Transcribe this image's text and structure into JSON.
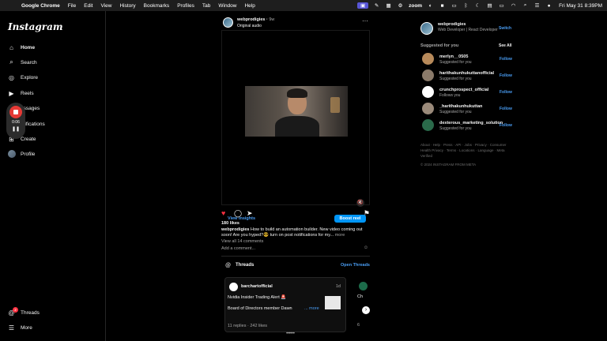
{
  "menubar": {
    "app": "Google Chrome",
    "menus": [
      "File",
      "Edit",
      "View",
      "History",
      "Bookmarks",
      "Profiles",
      "Tab",
      "Window",
      "Help"
    ],
    "zoom_label": "zoom",
    "clock": "Fri May 31  8:39PM"
  },
  "sidebar": {
    "logo": "Instagram",
    "items": [
      {
        "label": "Home",
        "icon": "home-icon"
      },
      {
        "label": "Search",
        "icon": "search-icon"
      },
      {
        "label": "Explore",
        "icon": "compass-icon"
      },
      {
        "label": "Reels",
        "icon": "reels-icon"
      },
      {
        "label": "essages",
        "icon": "messenger-icon"
      },
      {
        "label": "otifications",
        "icon": "heart-icon"
      },
      {
        "label": "Create",
        "icon": "plus-square-icon"
      },
      {
        "label": "Profile",
        "icon": "avatar"
      }
    ],
    "threads": "Threads",
    "threads_badge": "2",
    "more": "More"
  },
  "recorder": {
    "time": "0:06"
  },
  "post": {
    "username": "webprodigies",
    "time": "9w",
    "audio": "Original audio",
    "view_insights": "View insights",
    "boost": "Boost reel",
    "likes": "180 likes",
    "caption_user": "webprodigies",
    "caption_text": "How to build an automation builder. New video coming out soon! Are you hyped?😎 turn on post notifications for my...",
    "caption_more": "more",
    "view_comments": "View all 14 comments",
    "add_comment": "Add a comment..."
  },
  "threads": {
    "title": "Threads",
    "open": "Open Threads",
    "card": {
      "name": "barchartofficial",
      "time": "1d",
      "line1": "Nvidia Insider Trading Alert 🚨",
      "line2": "Board of Directors member Dawn",
      "more": "... more",
      "stats": "11 replies  ·  242 likes"
    },
    "peek": {
      "text": "Ch",
      "stats": "6"
    },
    "pager": "• • • • • •"
  },
  "right": {
    "username": "webprodigies",
    "bio": "Web Developer | React Developer",
    "switch": "Switch",
    "suggested_title": "Suggested for you",
    "see_all": "See All",
    "suggestions": [
      {
        "name": "merlyn__0505",
        "sub": "Suggested for you",
        "follow": "Follow",
        "color": "#b88a5a"
      },
      {
        "name": "harithakunhukuttanofficial",
        "sub": "Suggested for you",
        "follow": "Follow",
        "color": "#8a7a6a"
      },
      {
        "name": "crunchprospect_official",
        "sub": "Follows you",
        "follow": "Follow",
        "color": "#ffffff"
      },
      {
        "name": "_harithakunhukuttan",
        "sub": "Suggested for you",
        "follow": "Follow",
        "color": "#9a8a7a"
      },
      {
        "name": "dexterous_marketing_solution",
        "sub": "Suggested for you",
        "follow": "Follow",
        "color": "#2a6a4a"
      }
    ],
    "footer": "About · Help · Press · API · Jobs · Privacy · Consumer Health Privacy · Terms · Locations · Language · Meta Verified",
    "copyright": "© 2024 INSTAGRAM FROM META"
  }
}
